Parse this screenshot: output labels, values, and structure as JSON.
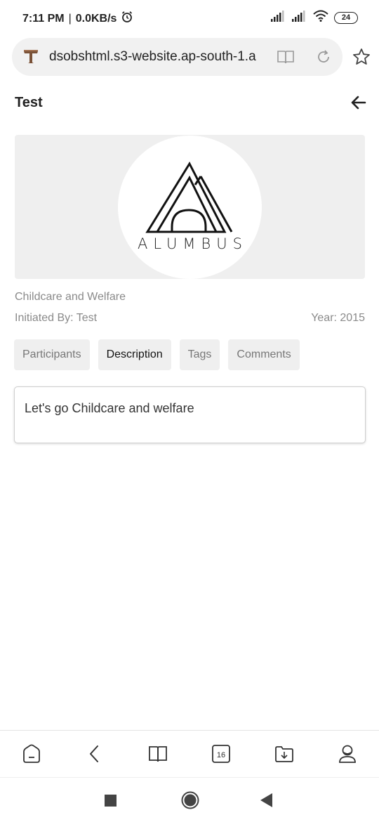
{
  "status_bar": {
    "time": "7:11 PM",
    "speed": "0.0KB/s",
    "battery": "24",
    "icons": [
      "alarm-icon",
      "signal-icon",
      "signal-icon",
      "wifi-icon",
      "battery-icon"
    ]
  },
  "browser": {
    "url": "dsobshtml.s3-website.ap-south-1.a",
    "icons": [
      "site-favicon",
      "reader-mode-icon",
      "reload-icon",
      "star-icon"
    ]
  },
  "page": {
    "title": "Test",
    "back_icon": "arrow-left-icon",
    "banner": {
      "logo_text": "ALUMBUS"
    },
    "category": "Childcare and Welfare",
    "initiated_by": "Initiated By: Test",
    "year": "Year: 2015",
    "tabs": [
      {
        "label": "Participants",
        "active": false
      },
      {
        "label": "Description",
        "active": true
      },
      {
        "label": "Tags",
        "active": false
      },
      {
        "label": "Comments",
        "active": false
      }
    ],
    "description": "Let's go Childcare and welfare"
  },
  "toolbar": {
    "tab_count": "16",
    "icons": [
      "home-icon",
      "back-icon",
      "bookmarks-icon",
      "tabs-icon",
      "downloads-icon",
      "profile-icon"
    ]
  },
  "nav": {
    "icons": [
      "recents-icon",
      "home-circle-icon",
      "back-triangle-icon"
    ]
  }
}
